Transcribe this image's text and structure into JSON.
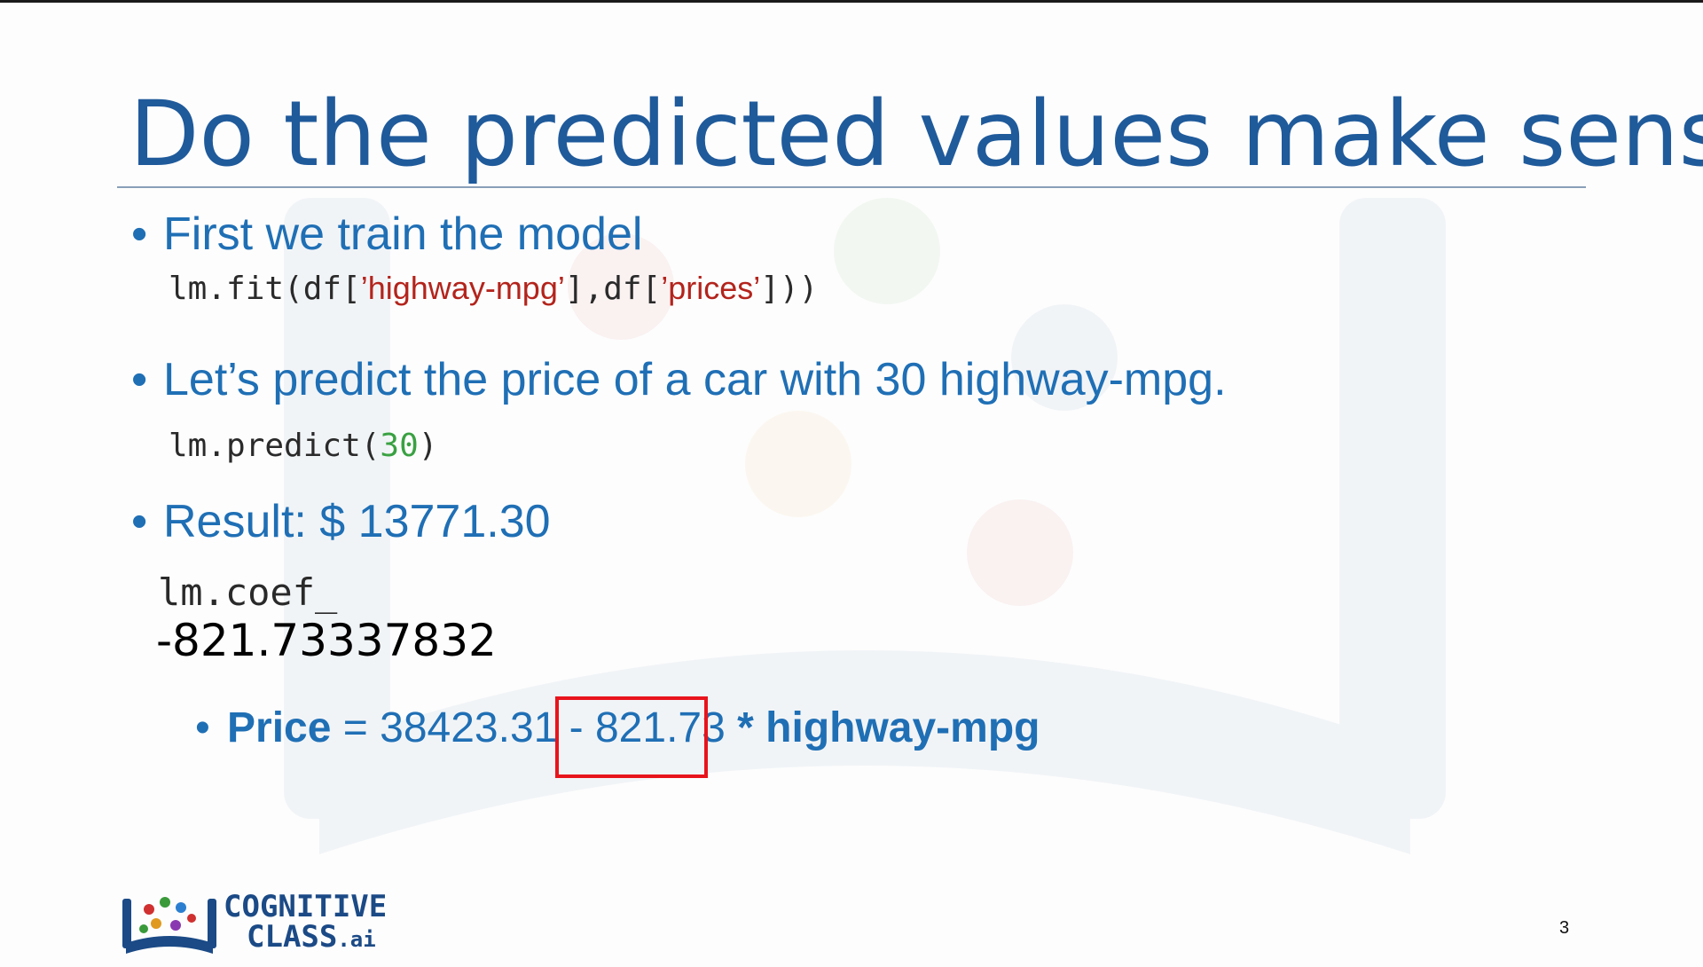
{
  "slide": {
    "title": "Do the predicted values make sense",
    "bullet1": "First we train the model",
    "code1": {
      "prefix": "lm.fit(df[",
      "str1": "’highway-mpg’",
      "mid": "],df[",
      "str2": "’prices’",
      "suffix": "]))"
    },
    "bullet2": "Let’s predict the price of a car with 30 highway-mpg.",
    "code2": {
      "prefix": "lm.predict(",
      "num": "30",
      "suffix": ")"
    },
    "bullet3": "Result: $ 13771.30",
    "code3": "lm.coef_",
    "coef_value": "-821.73337832",
    "formula": {
      "lhs": "Price",
      "eq": " = 38423.31 - ",
      "coef": "821.73",
      "rhs_op": " * ",
      "rhs_var": "highway-mpg"
    }
  },
  "logo": {
    "line1": "COGNITIVE",
    "line2": "CLASS",
    "suffix": ".ai"
  },
  "page_number": "3",
  "colors": {
    "title": "#1f5a9b",
    "bullet": "#1f6fb5",
    "string": "#b3241c",
    "number": "#3aa142",
    "highlight": "#e8141c"
  }
}
